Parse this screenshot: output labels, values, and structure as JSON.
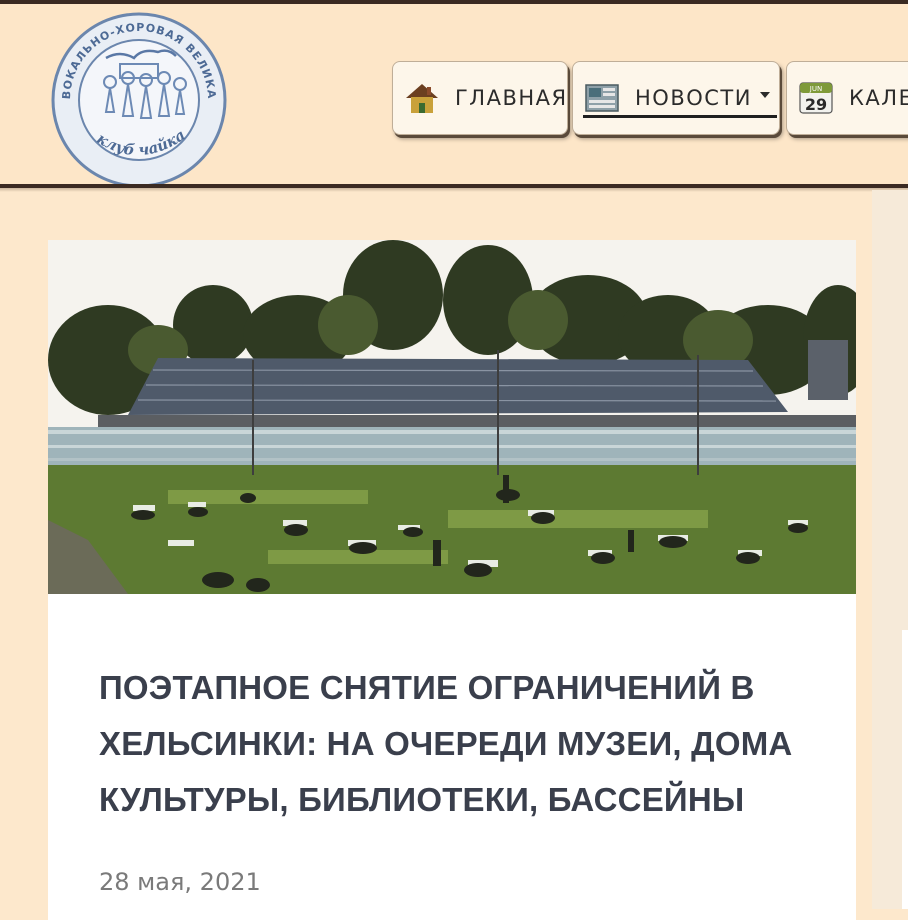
{
  "logo": {
    "arc_text": "ВОКАЛЬНО-ХОРОВАЯ ВЕЛИКА",
    "club_text": "клуб чайка"
  },
  "nav": {
    "items": [
      {
        "label": "ГЛАВНАЯ",
        "icon": "house-icon"
      },
      {
        "label": "НОВОСТИ",
        "icon": "newspaper-icon",
        "has_dropdown": true,
        "active": true
      },
      {
        "label": "КАЛЕ",
        "icon": "calendar-icon",
        "calendar_month": "JUN",
        "calendar_day": "29"
      }
    ]
  },
  "article": {
    "title": "ПОЭТАПНОЕ СНЯТИЕ ОГРАНИЧЕНИЙ В ХЕЛЬСИНКИ: НА ОЧЕРЕДИ МУЗЕИ, ДОМА КУЛЬТУРЫ, БИБЛИОТЕКИ, БАССЕЙНЫ",
    "date": "28 мая, 2021"
  },
  "colors": {
    "page_background": "#fde8cc",
    "header_rule": "#3b2a22",
    "title_text": "#3a3f4c",
    "date_text": "#7a7a7a"
  }
}
